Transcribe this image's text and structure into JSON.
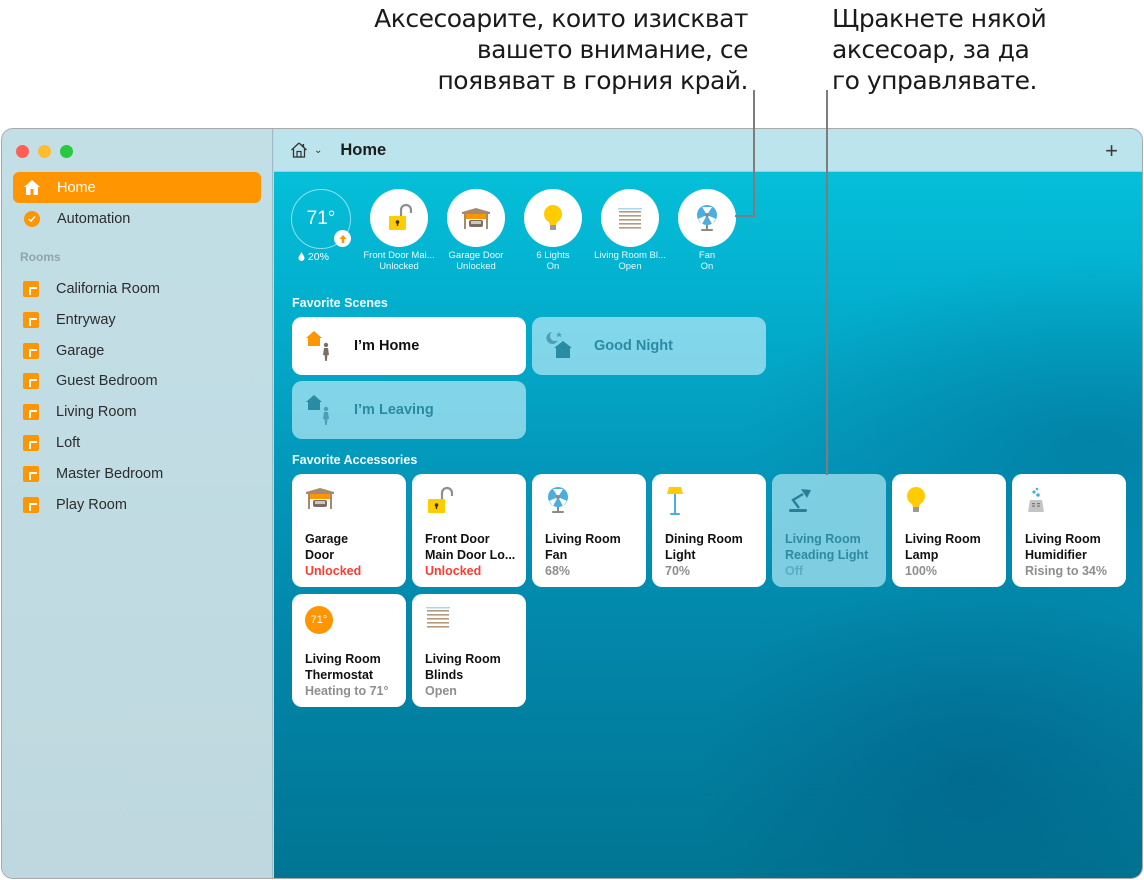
{
  "callouts": {
    "left": [
      "Аксесоарите, които изискват",
      "вашето внимание, се",
      "появяват в горния край."
    ],
    "right": [
      "Щракнете някой",
      "аксесоар, за да",
      "го управлявате."
    ]
  },
  "window": {
    "title": "Home",
    "add_button": "+",
    "home_icon": "house-icon",
    "traffic_lights": [
      "close",
      "minimize",
      "zoom"
    ]
  },
  "sidebar": {
    "items": [
      {
        "label": "Home",
        "icon": "house-icon",
        "active": true
      },
      {
        "label": "Automation",
        "icon": "clock-icon",
        "active": false
      }
    ],
    "rooms_label": "Rooms",
    "rooms": [
      "California Room",
      "Entryway",
      "Garage",
      "Guest Bedroom",
      "Living Room",
      "Loft",
      "Master Bedroom",
      "Play Room"
    ]
  },
  "status": {
    "temperature": "71°",
    "humidity": "20%",
    "items": [
      {
        "name": "Front Door Mai...",
        "state": "Unlocked",
        "icon": "lock-icon"
      },
      {
        "name": "Garage Door",
        "state": "Unlocked",
        "icon": "garage-icon"
      },
      {
        "name": "6 Lights",
        "state": "On",
        "icon": "bulb-icon"
      },
      {
        "name": "Living Room Bl...",
        "state": "Open",
        "icon": "blinds-icon"
      },
      {
        "name": "Fan",
        "state": "On",
        "icon": "fan-icon"
      }
    ]
  },
  "scenes": {
    "title": "Favorite Scenes",
    "items": [
      {
        "label": "I’m Home",
        "on": true
      },
      {
        "label": "Good Night",
        "on": false
      },
      {
        "label": "I’m Leaving",
        "on": false
      }
    ]
  },
  "accessories": {
    "title": "Favorite Accessories",
    "items": [
      {
        "name": [
          "Garage",
          "Door"
        ],
        "status": "Unlocked",
        "alert": true,
        "on": true,
        "icon": "garage-icon"
      },
      {
        "name": [
          "Front Door",
          "Main Door Lo..."
        ],
        "status": "Unlocked",
        "alert": true,
        "on": true,
        "icon": "lock-icon"
      },
      {
        "name": [
          "Living Room",
          "Fan"
        ],
        "status": "68%",
        "alert": false,
        "on": true,
        "icon": "fan-icon"
      },
      {
        "name": [
          "Dining Room",
          "Light"
        ],
        "status": "70%",
        "alert": false,
        "on": true,
        "icon": "floor-lamp-icon"
      },
      {
        "name": [
          "Living Room",
          "Reading Light"
        ],
        "status": "Off",
        "alert": false,
        "on": false,
        "icon": "desk-lamp-icon"
      },
      {
        "name": [
          "Living Room",
          "Lamp"
        ],
        "status": "100%",
        "alert": false,
        "on": true,
        "icon": "bulb-icon"
      },
      {
        "name": [
          "Living Room",
          "Humidifier"
        ],
        "status": "Rising to 34%",
        "alert": false,
        "on": true,
        "icon": "humidifier-icon"
      },
      {
        "name": [
          "Living Room",
          "Thermostat"
        ],
        "status": "Heating to 71°",
        "alert": false,
        "on": true,
        "icon": "thermostat-icon",
        "badge": "71°"
      },
      {
        "name": [
          "Living Room",
          "Blinds"
        ],
        "status": "Open",
        "alert": false,
        "on": true,
        "icon": "blinds-icon"
      }
    ]
  },
  "colors": {
    "accent": "#ff9500",
    "alert": "#ff3b30",
    "sidebar_bg": "#c2dde4",
    "main_bg_top": "#06c4dc",
    "main_bg_bottom": "#017593"
  }
}
